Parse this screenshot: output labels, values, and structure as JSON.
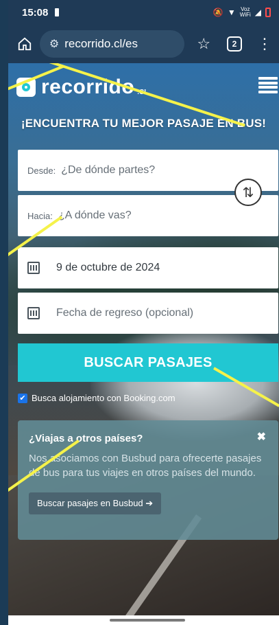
{
  "status_bar": {
    "time": "15:08",
    "icons": [
      "mute-icon",
      "wifi-icon",
      "volte-icon",
      "signal-icon",
      "battery-low-icon"
    ],
    "volte_label": "Voz\nWiFi"
  },
  "browser": {
    "url": "recorrido.cl/es",
    "tab_count": "2"
  },
  "header": {
    "logo_text": "recorrido",
    "logo_suffix": ".CL",
    "headline": "¡ENCUENTRA TU MEJOR PASAJE EN BUS!"
  },
  "form": {
    "origin": {
      "label": "Desde:",
      "placeholder": "¿De dónde partes?"
    },
    "destination": {
      "label": "Hacia:",
      "placeholder": "¿A dónde vas?"
    },
    "departure_date": "9 de octubre de 2024",
    "return_date_placeholder": "Fecha de regreso (opcional)",
    "search_button": "BUSCAR PASAJES",
    "booking_checkbox_label": "Busca alojamiento con Booking.com",
    "booking_checked": true
  },
  "info_card": {
    "title": "¿Viajas a otros países?",
    "close": "✖",
    "body": "Nos asociamos con Busbud para ofrecerte pasajes de bus para tus viajes en otros países del mundo.",
    "button": "Buscar pasajes en Busbud ➔"
  },
  "colors": {
    "accent": "#21c7d2",
    "annotation": "#f5f24a"
  }
}
